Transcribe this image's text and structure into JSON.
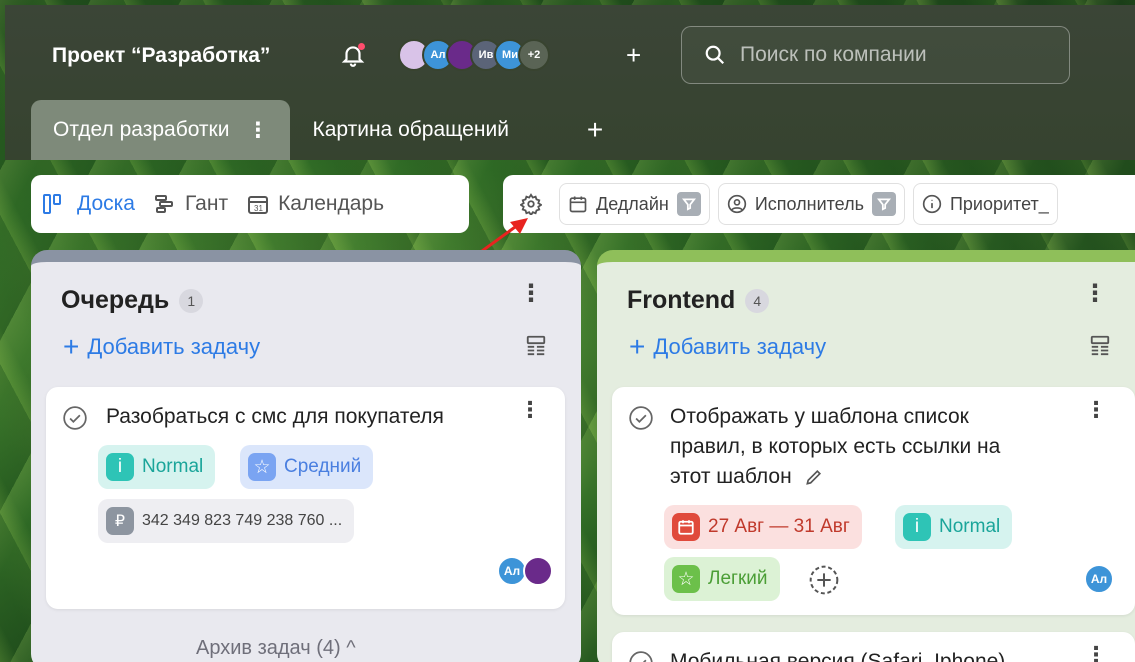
{
  "header": {
    "project_title": "Проект “Разработка”",
    "avatars": [
      {
        "label": "",
        "color": "#d9c3e8"
      },
      {
        "label": "Ал",
        "color": "#3d94d8"
      },
      {
        "label": "",
        "color": "#222222"
      },
      {
        "label": "Ив",
        "color": "#5b6478"
      },
      {
        "label": "Ми",
        "color": "#3d94d8"
      },
      {
        "label": "+2",
        "color": "#5a6455"
      }
    ],
    "search_placeholder": "Поиск по компании"
  },
  "tabs": [
    {
      "label": "Отдел разработки",
      "active": true
    },
    {
      "label": "Картина обращений",
      "active": false
    }
  ],
  "views": {
    "board": "Доска",
    "gantt": "Гант",
    "calendar": "Календарь"
  },
  "filters": {
    "deadline": "Дедлайн",
    "assignee": "Исполнитель",
    "priority": "Приоритет_"
  },
  "columns": [
    {
      "title": "Очередь",
      "count": "1",
      "add_task": "Добавить задачу",
      "cards": [
        {
          "title": "Разобраться с смс для покупателя",
          "tags": {
            "normal": "Normal",
            "level": "Средний",
            "amount": "342 349 823 749 238 760 ..."
          },
          "assignee": "Ал"
        }
      ],
      "archive": "Архив задач (4)"
    },
    {
      "title": "Frontend",
      "count": "4",
      "add_task": "Добавить задачу",
      "cards": [
        {
          "title_lines": [
            "Отображать у шаблона список",
            "правил, в которых есть ссылки на",
            "этот шаблон"
          ],
          "tags": {
            "date": "27 Авг — 31 Авг",
            "normal": "Normal",
            "level": "Легкий"
          },
          "assignee": "Ал"
        },
        {
          "title": "Мобильная версия (Safari, Iphone)"
        }
      ]
    }
  ],
  "colors": {
    "accent": "#2d7be5",
    "topbar": "#38432f"
  }
}
